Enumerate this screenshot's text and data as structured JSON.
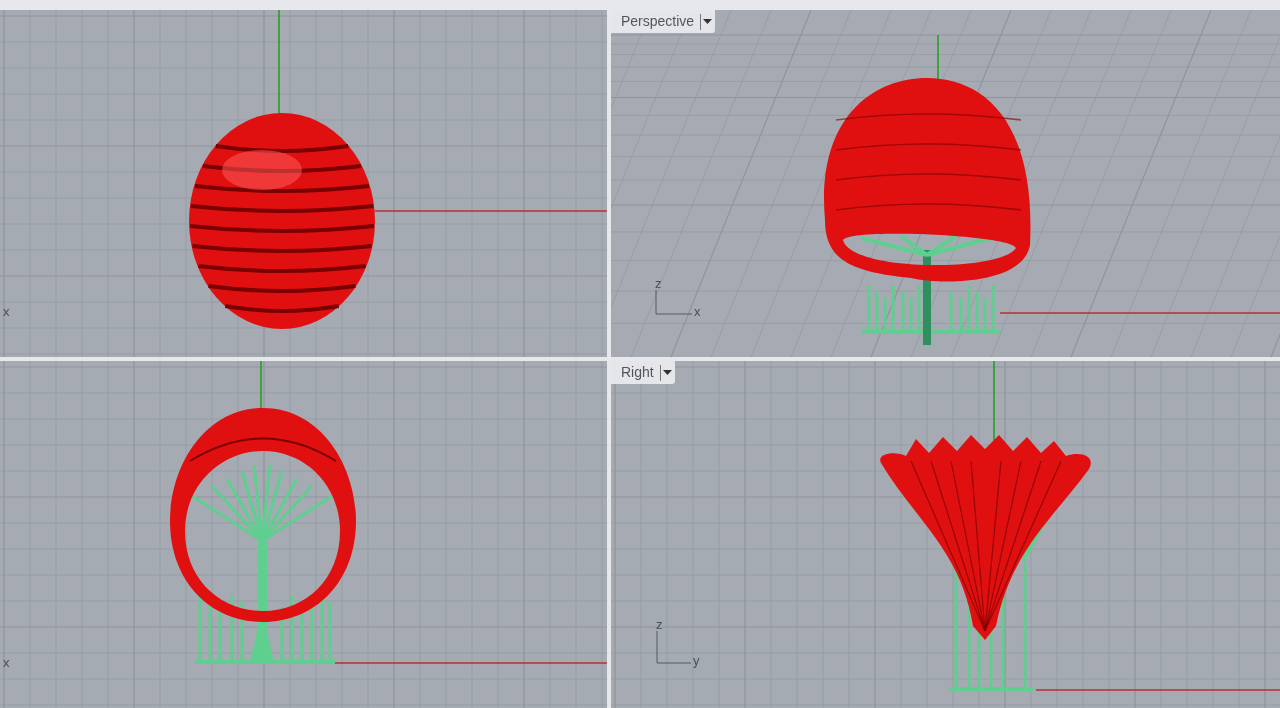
{
  "viewports": [
    {
      "kind": "top",
      "axes": [
        "x"
      ]
    },
    {
      "kind": "perspective",
      "label": "Perspective",
      "axes": [
        "z",
        "x"
      ]
    },
    {
      "kind": "front",
      "axes": [
        "x"
      ]
    },
    {
      "kind": "right",
      "label": "Right",
      "axes": [
        "z",
        "y"
      ]
    }
  ]
}
